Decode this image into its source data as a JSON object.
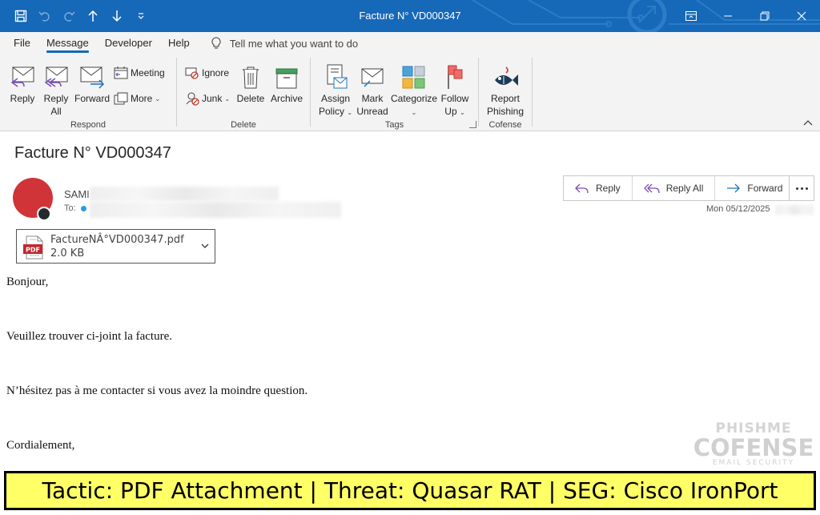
{
  "window": {
    "title": "Facture N° VD000347"
  },
  "tabs": [
    {
      "label": "File"
    },
    {
      "label": "Message"
    },
    {
      "label": "Developer"
    },
    {
      "label": "Help"
    }
  ],
  "tellme": {
    "label": "Tell me what you want to do"
  },
  "ribbon": {
    "respond": {
      "group_label": "Respond",
      "reply": "Reply",
      "reply_all_1": "Reply",
      "reply_all_2": "All",
      "forward": "Forward",
      "meeting": "Meeting",
      "more": "More"
    },
    "delete": {
      "group_label": "Delete",
      "ignore": "Ignore",
      "junk": "Junk",
      "delete": "Delete",
      "archive": "Archive"
    },
    "tags": {
      "group_label": "Tags",
      "assign_policy_1": "Assign",
      "assign_policy_2": "Policy",
      "mark_unread_1": "Mark",
      "mark_unread_2": "Unread",
      "categorize": "Categorize",
      "follow_up_1": "Follow",
      "follow_up_2": "Up"
    },
    "cofense": {
      "group_label": "Cofense",
      "report_1": "Report",
      "report_2": "Phishing"
    }
  },
  "message": {
    "subject": "Facture N° VD000347",
    "sender": "SAMI",
    "to_label": "To:",
    "date": "Mon 05/12/2025",
    "actions": {
      "reply": "Reply",
      "reply_all": "Reply All",
      "forward": "Forward"
    },
    "attachment": {
      "name": "FactureNÂ°VD000347.pdf",
      "size": "2.0 KB",
      "type_badge": "PDF"
    },
    "body": [
      "Bonjour,",
      "Veuillez trouver ci-joint la facture.",
      "N’hésitez pas à me contacter si vous avez la moindre question.",
      "Cordialement,"
    ]
  },
  "watermark": {
    "line1": "PHISHME",
    "line2": "COFENSE",
    "line3": "EMAIL SECURITY"
  },
  "banner": {
    "text": "Tactic: PDF Attachment | Threat: Quasar RAT | SEG: Cisco IronPort"
  },
  "colors": {
    "titlebar": "#1668b8",
    "avatar": "#d13438",
    "banner_bg": "#ffff66"
  }
}
